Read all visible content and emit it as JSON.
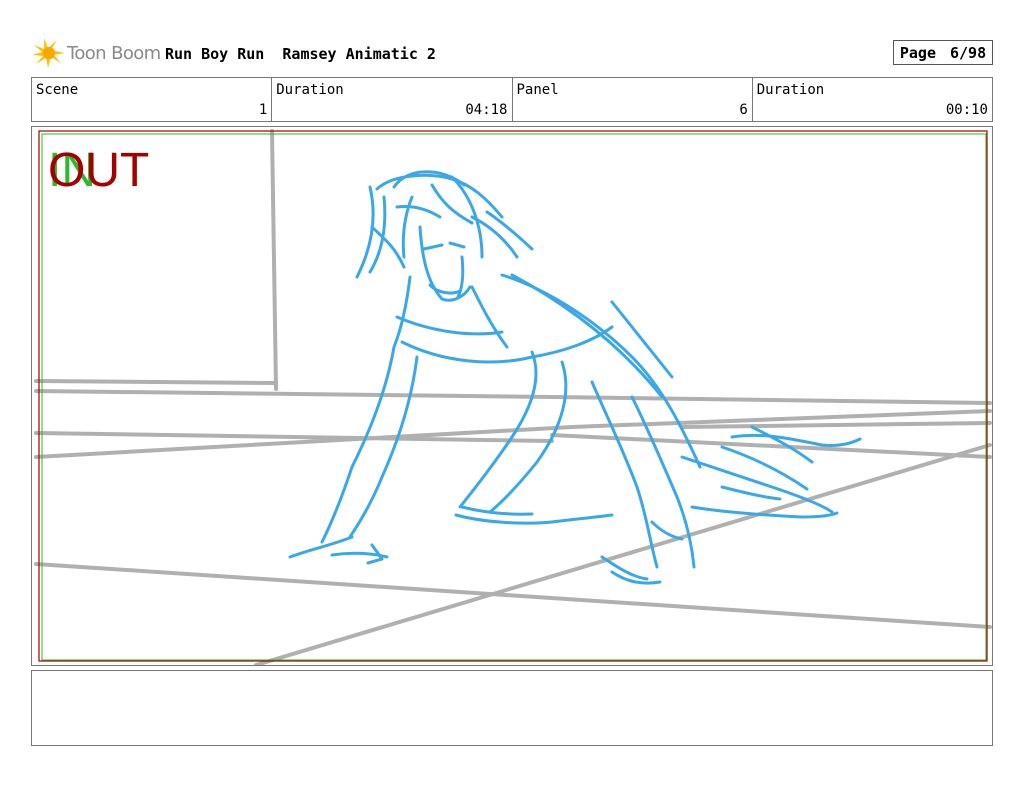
{
  "header": {
    "logo_text": "Toon Boom",
    "project": "Run Boy Run  Ramsey Animatic 2",
    "page_label": "Page",
    "page_value": "6/98"
  },
  "info": {
    "scene_label": "Scene",
    "scene_value": "1",
    "duration1_label": "Duration",
    "duration1_value": "04:18",
    "panel_label": "Panel",
    "panel_value": "6",
    "duration2_label": "Duration",
    "duration2_value": "00:10"
  },
  "frame": {
    "in_label": "IN",
    "out_label": "OUT",
    "in_color": "#2db82d",
    "out_color": "#a30000",
    "sketch_color": "#3aa8e8",
    "layout_color": "#b0b0b0"
  },
  "notes": {
    "text": ""
  }
}
